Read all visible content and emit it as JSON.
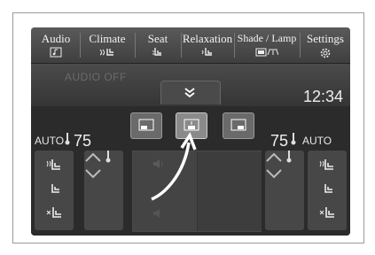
{
  "tabs": [
    {
      "label": "Audio",
      "icon": "audio-icon"
    },
    {
      "label": "Climate",
      "icon": "climate-seat-icon"
    },
    {
      "label": "Seat",
      "icon": "seat-icon"
    },
    {
      "label": "Relaxation",
      "icon": "relaxation-icon"
    },
    {
      "label": "Shade / Lamp",
      "icon": "shade-lamp-icon"
    },
    {
      "label": "Settings",
      "icon": "gear-icon"
    }
  ],
  "status": {
    "audio": "AUDIO OFF",
    "clock": "12:34"
  },
  "climate": {
    "left": {
      "mode": "AUTO",
      "temp": "75"
    },
    "right": {
      "temp": "75",
      "mode": "AUTO"
    },
    "zone_buttons": [
      "zone-left",
      "zone-rear",
      "zone-right"
    ],
    "selected_zone": 1
  },
  "colors": {
    "screen_bg": "#3a3a3a",
    "text": "#f0f0f0",
    "tab_bg": "#4a4a4a"
  }
}
